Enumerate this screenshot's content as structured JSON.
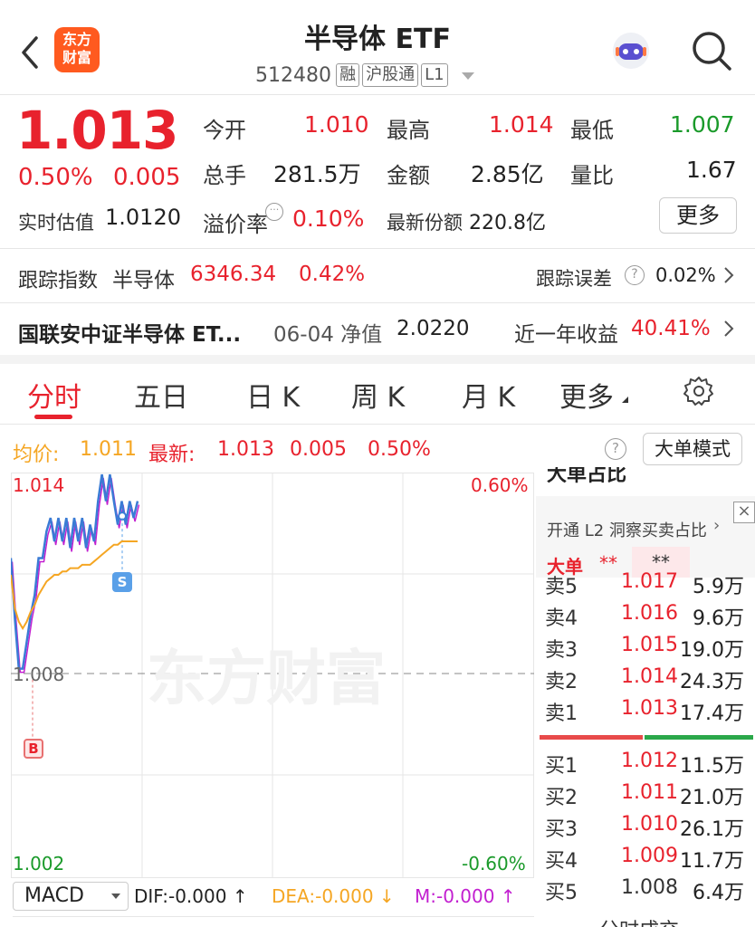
{
  "header": {
    "logo_line1": "东方",
    "logo_line2": "财富",
    "title": "半导体 ETF",
    "code": "512480",
    "tags": [
      "融",
      "沪股通",
      "L1"
    ]
  },
  "quote": {
    "price": "1.013",
    "pct": "0.50%",
    "chg": "0.005",
    "open_label": "今开",
    "open": "1.010",
    "high_label": "最高",
    "high": "1.014",
    "low_label": "最低",
    "low": "1.007",
    "vol_label": "总手",
    "vol": "281.5万",
    "amt_label": "金额",
    "amt": "2.85亿",
    "ratio_label": "量比",
    "ratio": "1.67",
    "iopv_label": "实时估值",
    "iopv": "1.0120",
    "premium_label": "溢价率",
    "premium": "0.10%",
    "shares_label": "最新份额",
    "shares": "220.8亿",
    "more": "更多"
  },
  "tracking": {
    "label": "跟踪指数",
    "index_name": "半导体",
    "index_value": "6346.34",
    "index_pct": "0.42%",
    "err_label": "跟踪误差",
    "err_value": "0.02%"
  },
  "fund": {
    "name": "国联安中证半导体 ET...",
    "nav_label": "06-04 净值",
    "nav": "2.0220",
    "yr_label": "近一年收益",
    "yr": "40.41%"
  },
  "tabs": [
    "分时",
    "五日",
    "日 K",
    "周 K",
    "月 K",
    "更多"
  ],
  "chart_info": {
    "avg_label": "均价:",
    "avg": "1.011",
    "last_label": "最新:",
    "last": "1.013",
    "last_chg": "0.005",
    "last_pct": "0.50%",
    "mode_btn": "大单模式"
  },
  "chart_axis": {
    "top": "1.014",
    "mid": "1.008",
    "bottom": "1.002",
    "top_pct": "0.60%",
    "bottom_pct": "-0.60%",
    "watermark": "东方财富",
    "buy_marker": "B",
    "sell_marker": "S"
  },
  "chart_data": {
    "type": "line",
    "ylim": [
      1.002,
      1.014
    ],
    "series": [
      {
        "values": [
          1.0115,
          1.0097,
          1.0082,
          1.0082,
          1.009,
          1.0098,
          1.0104,
          1.0115,
          1.0115,
          1.0123,
          1.0127,
          1.012,
          1.0127,
          1.012,
          1.0127,
          1.0118,
          1.0127,
          1.012,
          1.0127,
          1.0118,
          1.0125,
          1.012,
          1.0132,
          1.014,
          1.0132,
          1.014,
          1.0132,
          1.0125,
          1.0132,
          1.0125,
          1.0132,
          1.0127,
          1.0132
        ]
      },
      {
        "name": "均价",
        "values": [
          1.011,
          1.01,
          1.0096,
          1.0094,
          1.0096,
          1.0099,
          1.0101,
          1.0104,
          1.0106,
          1.0108,
          1.0109,
          1.011,
          1.011,
          1.0111,
          1.0111,
          1.0112,
          1.0112,
          1.0112,
          1.0113,
          1.0113,
          1.0113,
          1.0114,
          1.0115,
          1.0116,
          1.0117,
          1.0118,
          1.0119,
          1.0119,
          1.012,
          1.012,
          1.012,
          1.012,
          1.012
        ]
      }
    ]
  },
  "macd": {
    "name": "MACD",
    "dif": "DIF:-0.000 ↑",
    "dea": "DEA:-0.000 ↓",
    "m": "M:-0.000 ↑"
  },
  "orderbook": {
    "top_title": "大单占比",
    "l2_link": "开通 L2 洞察买卖占比",
    "big_label": "大单",
    "big_val": "**",
    "sells": [
      {
        "label": "卖5",
        "price": "1.017",
        "vol": "5.9万"
      },
      {
        "label": "卖4",
        "price": "1.016",
        "vol": "9.6万"
      },
      {
        "label": "卖3",
        "price": "1.015",
        "vol": "19.0万"
      },
      {
        "label": "卖2",
        "price": "1.014",
        "vol": "24.3万"
      },
      {
        "label": "卖1",
        "price": "1.013",
        "vol": "17.4万"
      }
    ],
    "buys": [
      {
        "label": "买1",
        "price": "1.012",
        "vol": "11.5万"
      },
      {
        "label": "买2",
        "price": "1.011",
        "vol": "21.0万"
      },
      {
        "label": "买3",
        "price": "1.010",
        "vol": "26.1万"
      },
      {
        "label": "买4",
        "price": "1.009",
        "vol": "11.7万"
      },
      {
        "label": "买5",
        "price": "1.008",
        "vol": "6.4万"
      }
    ],
    "footer": "分时成交"
  },
  "colors": {
    "up": "#e8222d",
    "down": "#1a9a2a",
    "accent": "#ff6a00"
  }
}
